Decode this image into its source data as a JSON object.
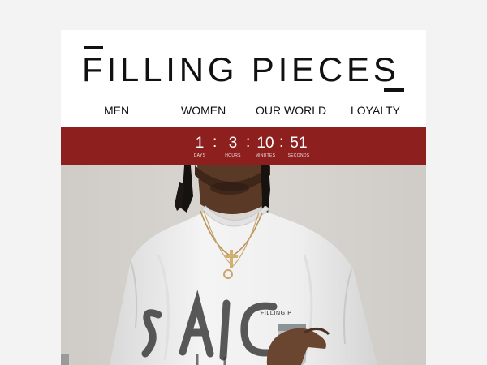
{
  "brand": {
    "logo_text": "FILLING PIECES"
  },
  "nav": {
    "items": [
      {
        "label": "MEN"
      },
      {
        "label": "WOMEN"
      },
      {
        "label": "OUR WORLD"
      },
      {
        "label": "LOYALTY"
      }
    ]
  },
  "countdown": {
    "days": "1",
    "hours": "3",
    "minutes": "10",
    "seconds": "51",
    "separator": ":",
    "labels": {
      "days": "DAYS",
      "hours": "HOURS",
      "minutes": "MINUTES",
      "seconds": "SECONDS"
    }
  },
  "hero": {
    "shirt_print": "FILLING P",
    "graffiti_text": "SAIC"
  },
  "colors": {
    "page_background": "#f3f3f3",
    "card_background": "#ffffff",
    "countdown_background": "#8e1f1f",
    "text": "#111111"
  }
}
